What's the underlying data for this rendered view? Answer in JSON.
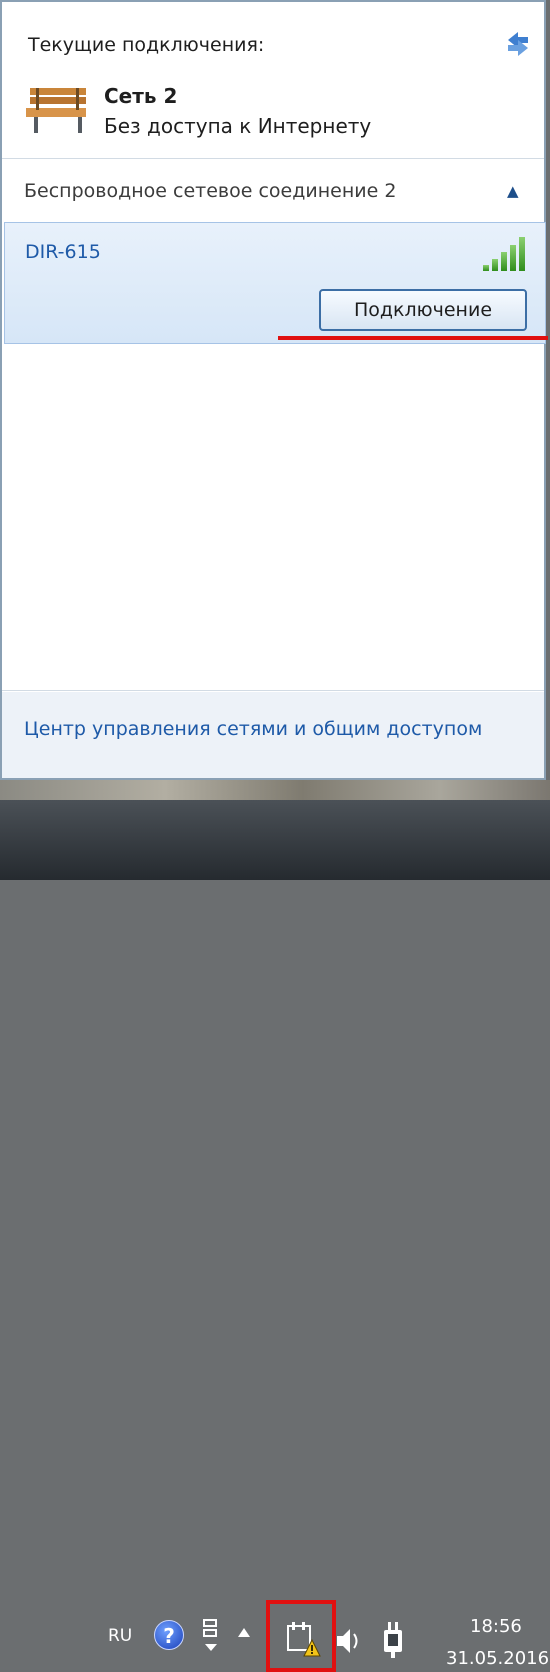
{
  "popup": {
    "header": "Текущие подключения:",
    "refresh_icon": "refresh-arrows-icon",
    "current_network": {
      "icon": "bench-public-network-icon",
      "name": "Сеть  2",
      "status": "Без доступа к Интернету"
    },
    "wireless_section": {
      "title": "Беспроводное сетевое соединение 2",
      "collapse_icon": "chevron-up-icon",
      "networks": [
        {
          "ssid": "DIR-615",
          "signal_icon": "signal-strength-icon",
          "signal_bars_lit": 5,
          "connect_label": "Подключение"
        }
      ]
    },
    "footer_link": "Центр управления сетями и общим доступом"
  },
  "taskbar": {
    "language": "RU",
    "help_icon": "help-question-icon",
    "help_glyph": "?",
    "network_icon": "network-arrows-icon",
    "show_hidden_icon": "up-triangle-icon",
    "network_warning_icon": "network-warning-icon",
    "volume_icon": "speaker-icon",
    "power_icon": "power-plug-icon",
    "time": "18:56",
    "date": "31.05.2016"
  },
  "colors": {
    "link": "#1e5aa8",
    "selection_bg": "#dbe8f6",
    "highlight_red": "#e01010",
    "taskbar": "#2c3136"
  }
}
